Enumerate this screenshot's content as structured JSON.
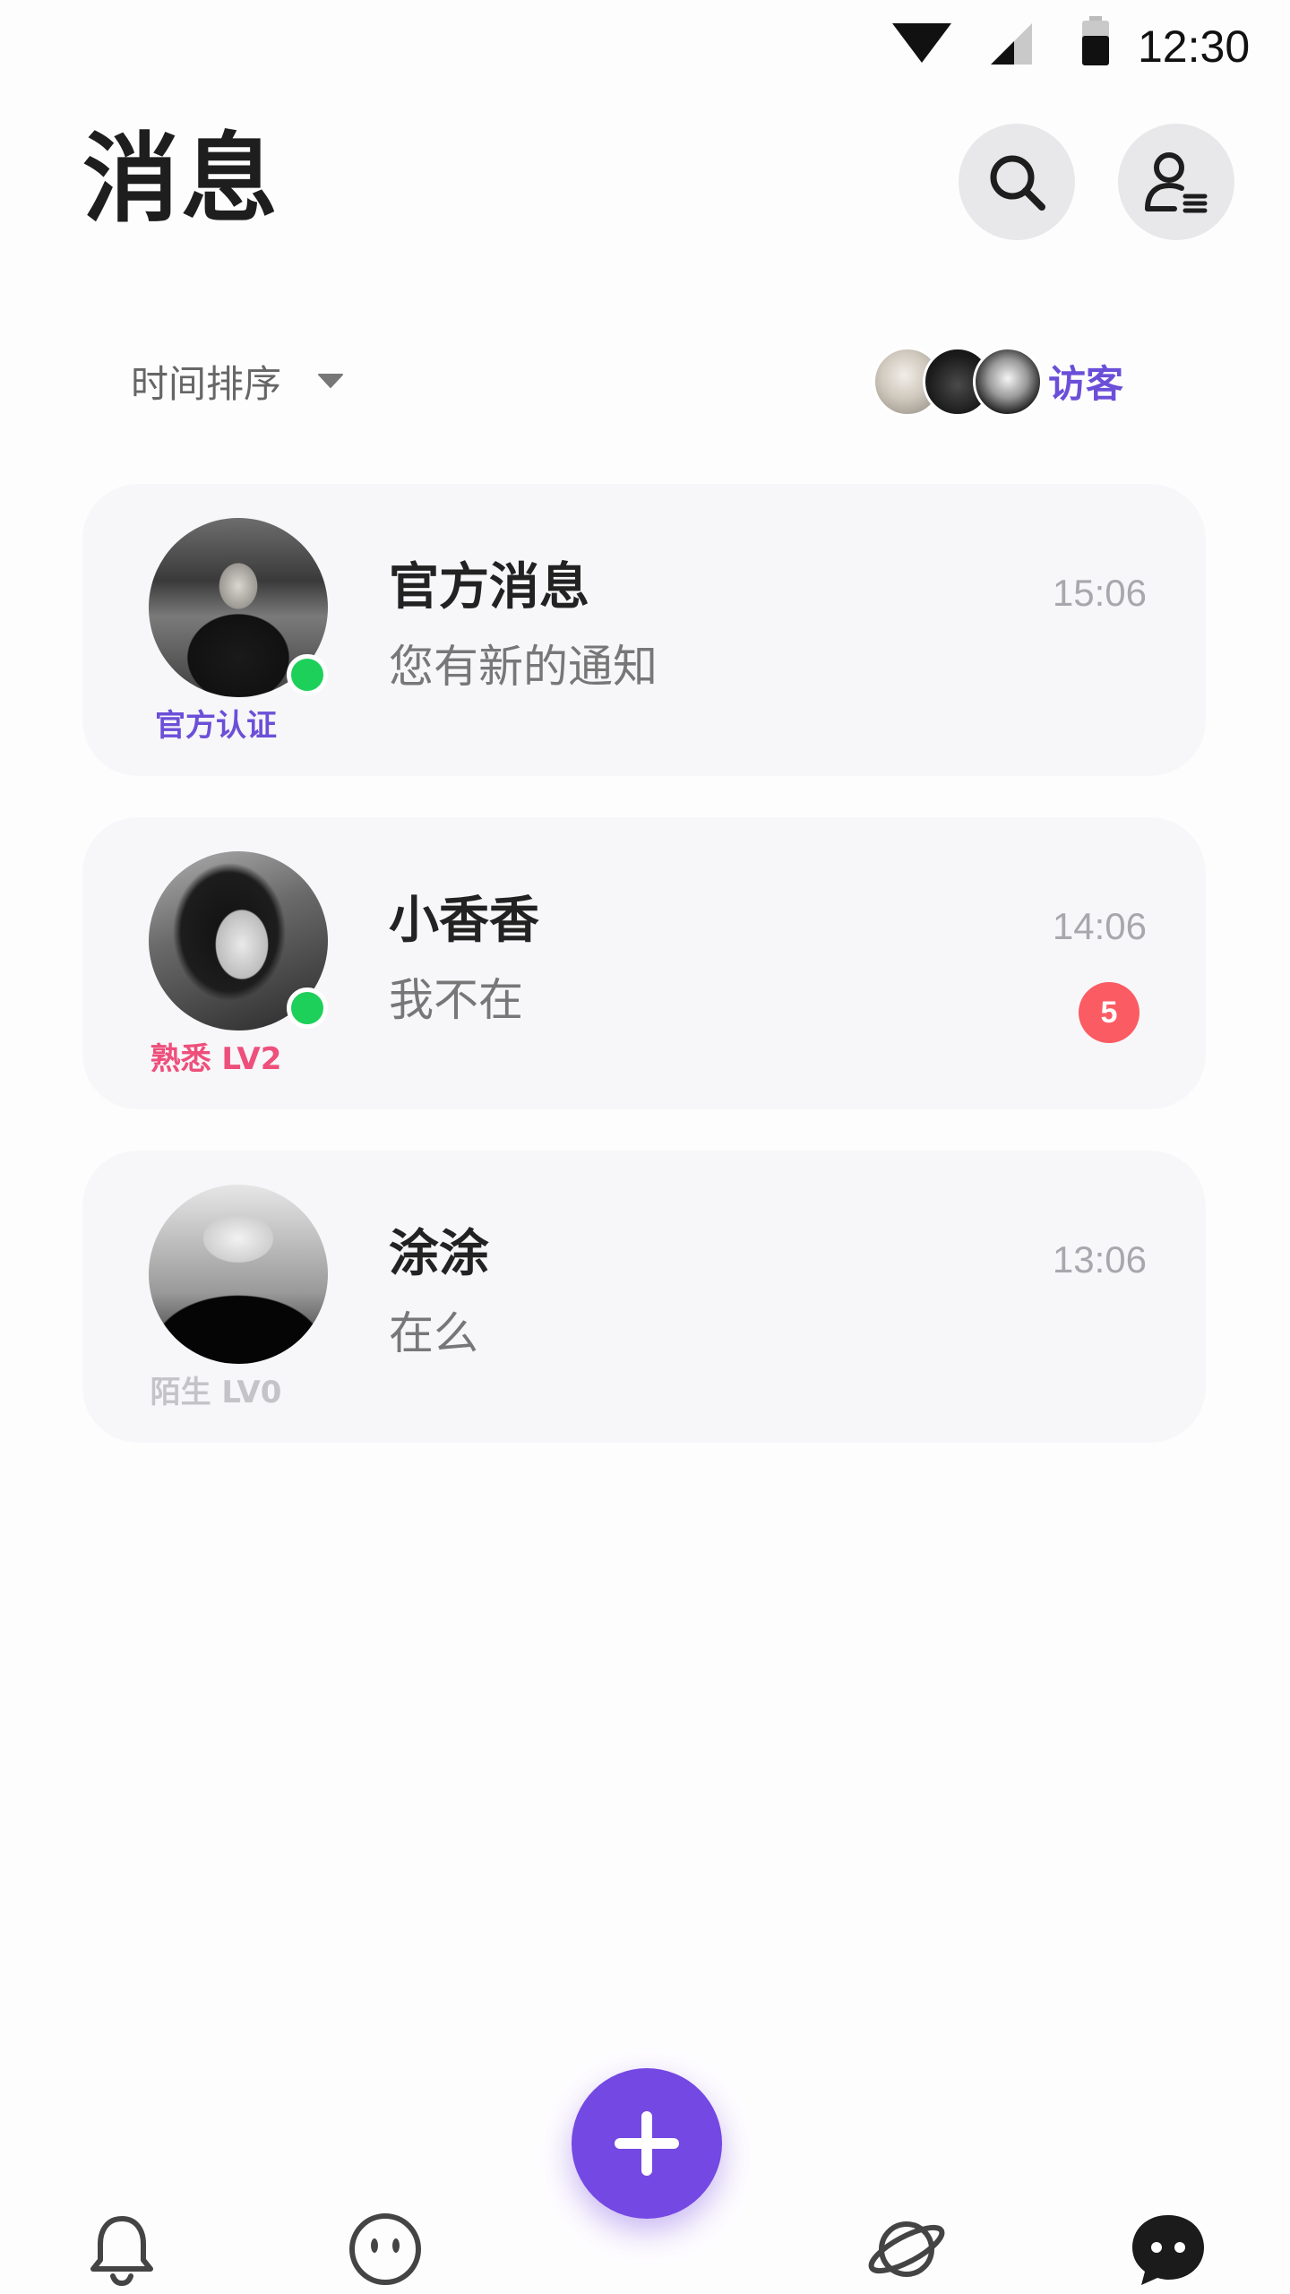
{
  "status_bar": {
    "time": "12:30",
    "icons": [
      "wifi-icon",
      "signal-icon",
      "battery-icon"
    ]
  },
  "header": {
    "title": "消息",
    "actions": [
      "search-icon",
      "profile-list-icon"
    ]
  },
  "sort": {
    "label": "时间排序",
    "icon": "caret-down-icon"
  },
  "visitors": {
    "label": "访客",
    "avatar_count": 3
  },
  "conversations": [
    {
      "name": "官方消息",
      "preview": "您有新的通知",
      "time": "15:06",
      "tag": "官方认证",
      "tag_color": "#6b4fd8",
      "online": true,
      "unread": null
    },
    {
      "name": "小香香",
      "preview": "我不在",
      "time": "14:06",
      "tag": "熟悉 LV2",
      "tag_color": "#ee4f7b",
      "online": true,
      "unread": "5"
    },
    {
      "name": "涂涂",
      "preview": "在么",
      "time": "13:06",
      "tag": "陌生 LV0",
      "tag_color": "#c4c4c8",
      "online": false,
      "unread": null
    }
  ],
  "bottom_nav": {
    "items": [
      "bell-icon",
      "face-icon",
      "planet-icon",
      "chat-bubble-icon"
    ],
    "active": "chat-bubble-icon",
    "fab_icon": "plus-icon"
  },
  "colors": {
    "accent": "#7448e3",
    "online": "#1dd05a",
    "badge": "#fb5b62",
    "card_bg": "#f7f6f9"
  }
}
